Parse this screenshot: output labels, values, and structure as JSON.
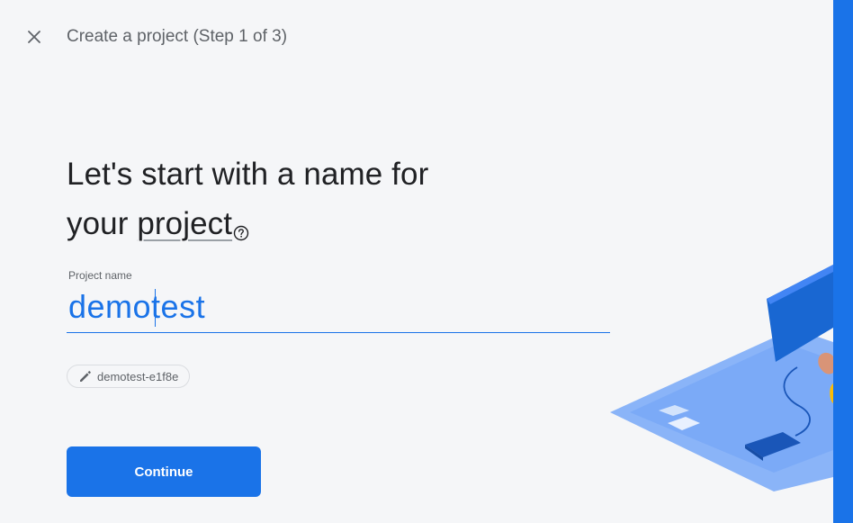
{
  "header": {
    "title": "Create a project (Step 1 of 3)",
    "close_icon": "close-icon"
  },
  "main": {
    "headline_line1": "Let's start with a name for",
    "headline_prefix": "your ",
    "headline_term": "project",
    "help_icon": "help-circle-icon"
  },
  "project_name": {
    "label": "Project name",
    "value": "demotest"
  },
  "project_id_chip": {
    "icon": "pencil-icon",
    "text": "demotest-e1f8e"
  },
  "actions": {
    "continue_label": "Continue"
  },
  "colors": {
    "accent": "#1a73e8",
    "background": "#f5f6f8",
    "text_primary": "#202124",
    "text_secondary": "#5f6368"
  }
}
